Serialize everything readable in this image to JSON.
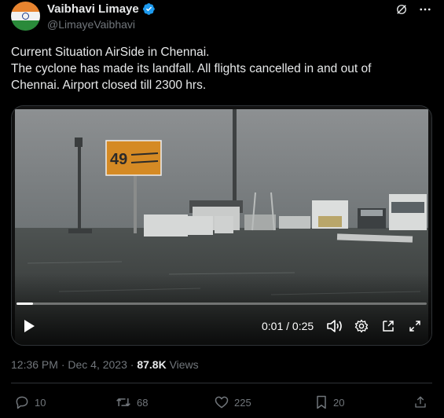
{
  "author": {
    "display_name": "Vaibhavi Limaye",
    "handle": "@LimayeVaibhavi",
    "verified": true
  },
  "tweet": {
    "lines": [
      "Current Situation AirSide in Chennai.",
      "The cyclone has made its landfall. All flights cancelled in and out of",
      "Chennai. Airport closed till 2300 hrs."
    ]
  },
  "video": {
    "time_display": "0:01 / 0:25",
    "progress_fraction": 0.04,
    "sign_number": "49"
  },
  "meta": {
    "timestamp": "12:36 PM · Dec 4, 2023",
    "separator": " · ",
    "views_count": "87.8K",
    "views_label": " Views"
  },
  "actions": {
    "replies": "10",
    "reposts": "68",
    "likes": "225",
    "bookmarks": "20"
  },
  "colors": {
    "background": "#000000",
    "text": "#e7e9ea",
    "muted": "#71767b",
    "verified_blue": "#1d9bf0",
    "border": "#2f3336"
  },
  "icons": [
    "grok-icon",
    "more-icon",
    "verified-badge-icon",
    "play-icon",
    "volume-icon",
    "settings-icon",
    "pip-icon",
    "fullscreen-icon",
    "reply-icon",
    "repost-icon",
    "like-icon",
    "bookmark-icon",
    "share-icon"
  ]
}
